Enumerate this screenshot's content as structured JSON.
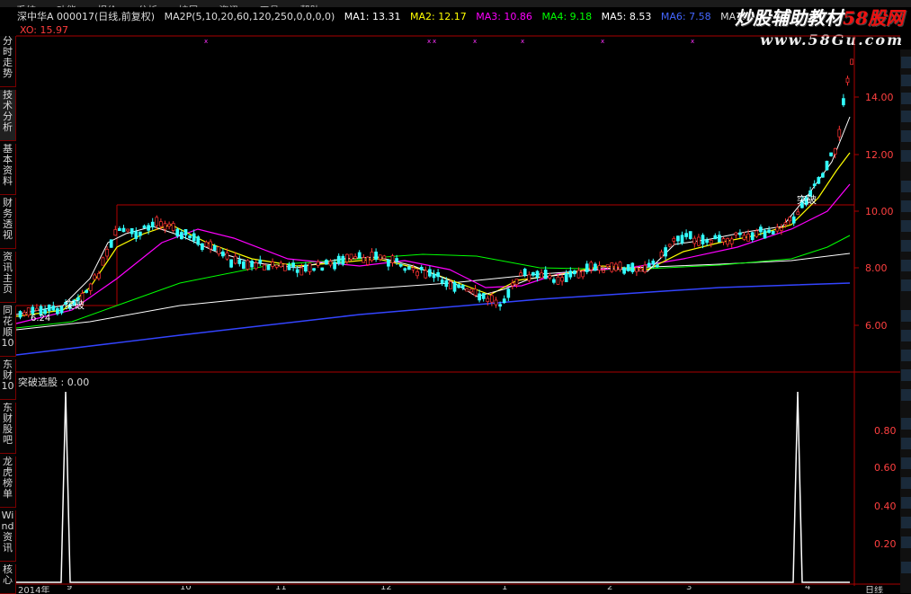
{
  "menubar": {
    "items": [
      "系统",
      "功能",
      "报价",
      "分析",
      "扩展",
      "资讯",
      "工具",
      "帮助"
    ]
  },
  "left_tabs": [
    "分时走势",
    "技术分析",
    "基本资料",
    "财务透视",
    "资讯主页",
    "同花顺10",
    "东财10",
    "东财股吧",
    "龙虎榜单",
    "Wind资讯",
    "核心"
  ],
  "infobar": {
    "stock": "深中华A 000017(日线,前复权)",
    "ma_param": "MA2P(5,10,20,60,120,250,0,0,0,0)",
    "ma1": "MA1: 13.31",
    "ma2": "MA2: 12.17",
    "ma3": "MA3: 10.86",
    "ma4": "MA4: 9.18",
    "ma5": "MA5: 8.53",
    "ma6": "MA6: 7.58",
    "ma7": "MA7: -"
  },
  "xo": "XO: 15.97",
  "watermark": {
    "line1": "炒股辅助教材",
    "line1_red": "58股网",
    "line2": "www.58Gu.com"
  },
  "price_axis": [
    "14.00",
    "12.00",
    "10.00",
    "8.00",
    "6.00"
  ],
  "sub_axis": [
    "0.80",
    "0.60",
    "0.40",
    "0.20"
  ],
  "annotations": {
    "breakout1": "突破",
    "breakout2": "突破",
    "low_label": "6.24"
  },
  "sub_title": "突破选股 : 0.00",
  "bottom_axis": [
    "2014年",
    "9",
    "10",
    "11",
    "12",
    "1",
    "2",
    "3",
    "4",
    "日线"
  ],
  "colors": {
    "ma1": "#ffffff",
    "ma2": "#ffff00",
    "ma3": "#ff00ff",
    "ma4": "#00ff00",
    "ma5": "#ffffff",
    "ma6": "#3344ff",
    "border": "#aa0000"
  }
}
